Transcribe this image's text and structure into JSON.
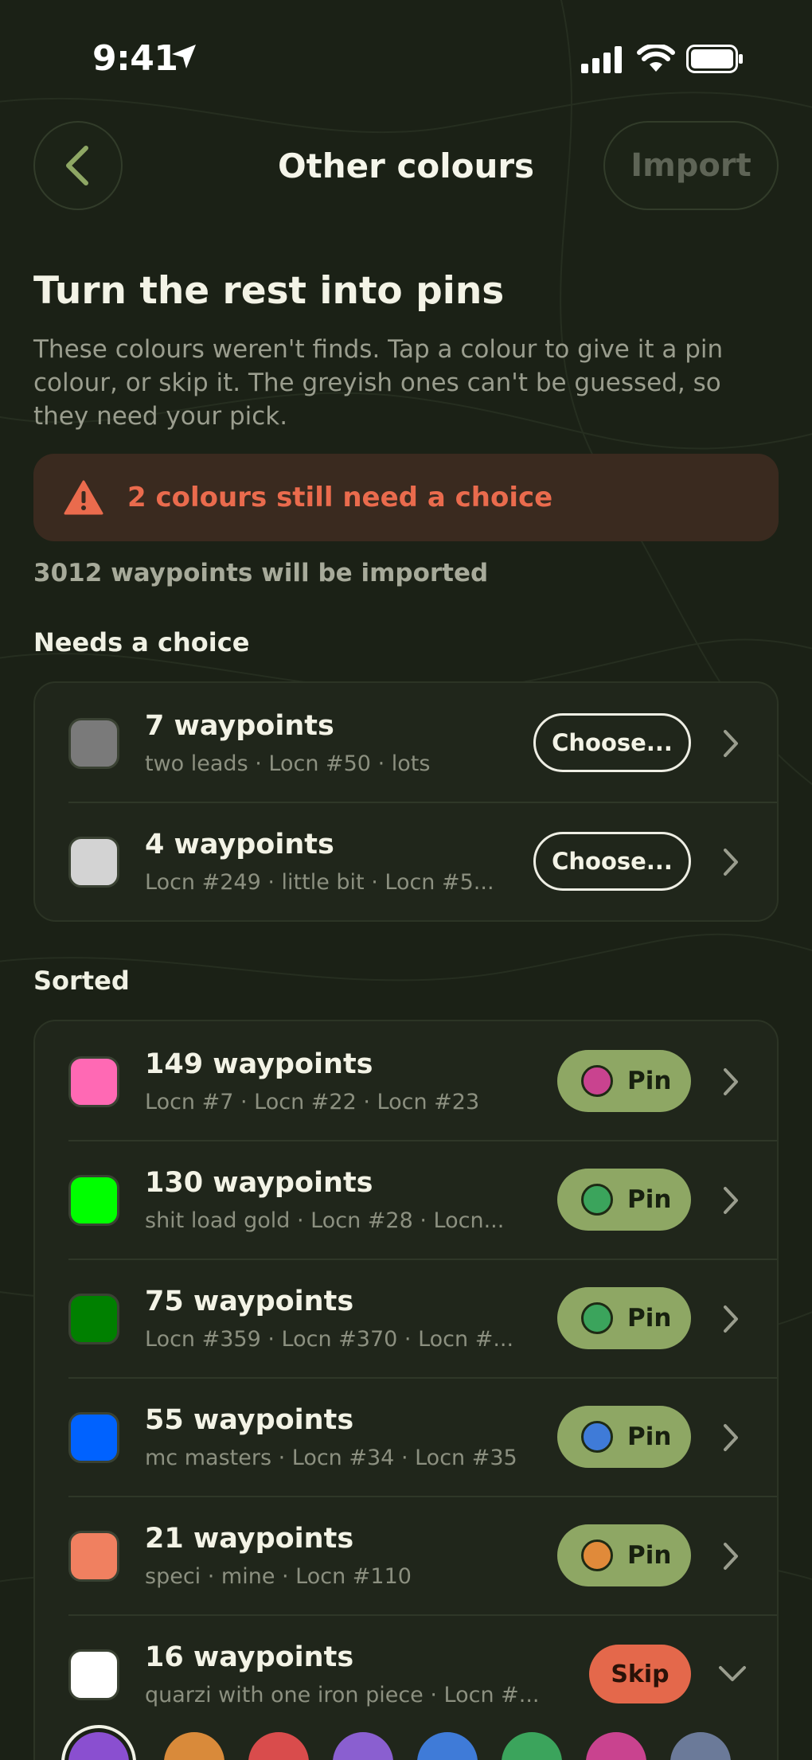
{
  "status_bar": {
    "time": "9:41"
  },
  "nav": {
    "title": "Other colours",
    "import_label": "Import"
  },
  "header": {
    "title": "Turn the rest into pins",
    "description": "These colours weren't finds. Tap a colour to give it a pin colour, or skip it. The greyish ones can't be guessed, so they need your pick."
  },
  "alert": {
    "text": "2 colours still need a choice",
    "icon": "warning-icon"
  },
  "summary": {
    "count_text": "3012 waypoints will be imported"
  },
  "needs_choice": {
    "title": "Needs a choice",
    "items": [
      {
        "title": "7 waypoints",
        "subtitle": "two leads · Locn #50 · lots",
        "color": "#7a7a7a",
        "action": "Choose..."
      },
      {
        "title": "4 waypoints",
        "subtitle": "Locn #249 · little bit  · Locn #5...",
        "color": "#d3d3d3",
        "action": "Choose..."
      }
    ]
  },
  "sorted": {
    "title": "Sorted",
    "items": [
      {
        "title": "149 waypoints",
        "subtitle": "Locn #7 · Locn #22 · Locn #23",
        "color": "#ff69b4",
        "action": "Pin",
        "pin_color": "#c9438f"
      },
      {
        "title": "130 waypoints",
        "subtitle": "shit load gold · Locn #28 · Locn...",
        "color": "#00ff00",
        "action": "Pin",
        "pin_color": "#3ba45c"
      },
      {
        "title": "75 waypoints",
        "subtitle": "Locn #359 · Locn #370 · Locn #...",
        "color": "#008000",
        "action": "Pin",
        "pin_color": "#3ba45c"
      },
      {
        "title": "55 waypoints",
        "subtitle": "mc masters · Locn #34 · Locn #35",
        "color": "#0062ff",
        "action": "Pin",
        "pin_color": "#3f7bd8"
      },
      {
        "title": "21 waypoints",
        "subtitle": "speci · mine  · Locn #110",
        "color": "#f08060",
        "action": "Pin",
        "pin_color": "#e08a3a"
      },
      {
        "title": "16 waypoints",
        "subtitle": "quarzi with one iron piece  · Locn #...",
        "color": "#ffffff",
        "action": "Skip"
      }
    ]
  },
  "pin_palette": [
    "#8a4fd0",
    "#d98a3a",
    "#d94c4c",
    "#8a5fd0",
    "#3f7bd8",
    "#3ba45c",
    "#c9438f",
    "#6b7a99"
  ]
}
